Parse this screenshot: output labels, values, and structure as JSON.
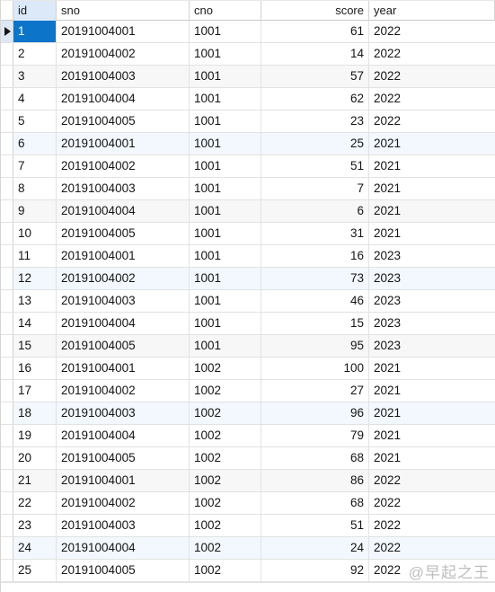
{
  "table": {
    "columns": [
      {
        "key": "id",
        "label": "id",
        "align": "left"
      },
      {
        "key": "sno",
        "label": "sno",
        "align": "left"
      },
      {
        "key": "cno",
        "label": "cno",
        "align": "left"
      },
      {
        "key": "score",
        "label": "score",
        "align": "right"
      },
      {
        "key": "year",
        "label": "year",
        "align": "left"
      }
    ],
    "selected_column": "id",
    "selected_row_index": 0,
    "row_count": 25,
    "rows": [
      {
        "id": "1",
        "sno": "20191004001",
        "cno": "1001",
        "score": "61",
        "year": "2022",
        "tint": "none"
      },
      {
        "id": "2",
        "sno": "20191004002",
        "cno": "1001",
        "score": "14",
        "year": "2022",
        "tint": "none"
      },
      {
        "id": "3",
        "sno": "20191004003",
        "cno": "1001",
        "score": "57",
        "year": "2022",
        "tint": "gray"
      },
      {
        "id": "4",
        "sno": "20191004004",
        "cno": "1001",
        "score": "62",
        "year": "2022",
        "tint": "none"
      },
      {
        "id": "5",
        "sno": "20191004005",
        "cno": "1001",
        "score": "23",
        "year": "2022",
        "tint": "none"
      },
      {
        "id": "6",
        "sno": "20191004001",
        "cno": "1001",
        "score": "25",
        "year": "2021",
        "tint": "blue"
      },
      {
        "id": "7",
        "sno": "20191004002",
        "cno": "1001",
        "score": "51",
        "year": "2021",
        "tint": "none"
      },
      {
        "id": "8",
        "sno": "20191004003",
        "cno": "1001",
        "score": "7",
        "year": "2021",
        "tint": "none"
      },
      {
        "id": "9",
        "sno": "20191004004",
        "cno": "1001",
        "score": "6",
        "year": "2021",
        "tint": "gray"
      },
      {
        "id": "10",
        "sno": "20191004005",
        "cno": "1001",
        "score": "31",
        "year": "2021",
        "tint": "none"
      },
      {
        "id": "11",
        "sno": "20191004001",
        "cno": "1001",
        "score": "16",
        "year": "2023",
        "tint": "none"
      },
      {
        "id": "12",
        "sno": "20191004002",
        "cno": "1001",
        "score": "73",
        "year": "2023",
        "tint": "blue"
      },
      {
        "id": "13",
        "sno": "20191004003",
        "cno": "1001",
        "score": "46",
        "year": "2023",
        "tint": "none"
      },
      {
        "id": "14",
        "sno": "20191004004",
        "cno": "1001",
        "score": "15",
        "year": "2023",
        "tint": "none"
      },
      {
        "id": "15",
        "sno": "20191004005",
        "cno": "1001",
        "score": "95",
        "year": "2023",
        "tint": "gray"
      },
      {
        "id": "16",
        "sno": "20191004001",
        "cno": "1002",
        "score": "100",
        "year": "2021",
        "tint": "none"
      },
      {
        "id": "17",
        "sno": "20191004002",
        "cno": "1002",
        "score": "27",
        "year": "2021",
        "tint": "none"
      },
      {
        "id": "18",
        "sno": "20191004003",
        "cno": "1002",
        "score": "96",
        "year": "2021",
        "tint": "blue"
      },
      {
        "id": "19",
        "sno": "20191004004",
        "cno": "1002",
        "score": "79",
        "year": "2021",
        "tint": "none"
      },
      {
        "id": "20",
        "sno": "20191004005",
        "cno": "1002",
        "score": "68",
        "year": "2021",
        "tint": "none"
      },
      {
        "id": "21",
        "sno": "20191004001",
        "cno": "1002",
        "score": "86",
        "year": "2022",
        "tint": "gray"
      },
      {
        "id": "22",
        "sno": "20191004002",
        "cno": "1002",
        "score": "68",
        "year": "2022",
        "tint": "none"
      },
      {
        "id": "23",
        "sno": "20191004003",
        "cno": "1002",
        "score": "51",
        "year": "2022",
        "tint": "none"
      },
      {
        "id": "24",
        "sno": "20191004004",
        "cno": "1002",
        "score": "24",
        "year": "2022",
        "tint": "blue"
      },
      {
        "id": "25",
        "sno": "20191004005",
        "cno": "1002",
        "score": "92",
        "year": "2022",
        "tint": "none"
      }
    ]
  },
  "watermark": {
    "text": "@早起之王"
  },
  "colors": {
    "selection_blue": "#0c74c9",
    "header_selected_column": "#dbe9f8",
    "row_tint_blue": "#f2f8fd",
    "row_tint_gray": "#f7f7f7",
    "grid_line": "#e2e2e2"
  }
}
